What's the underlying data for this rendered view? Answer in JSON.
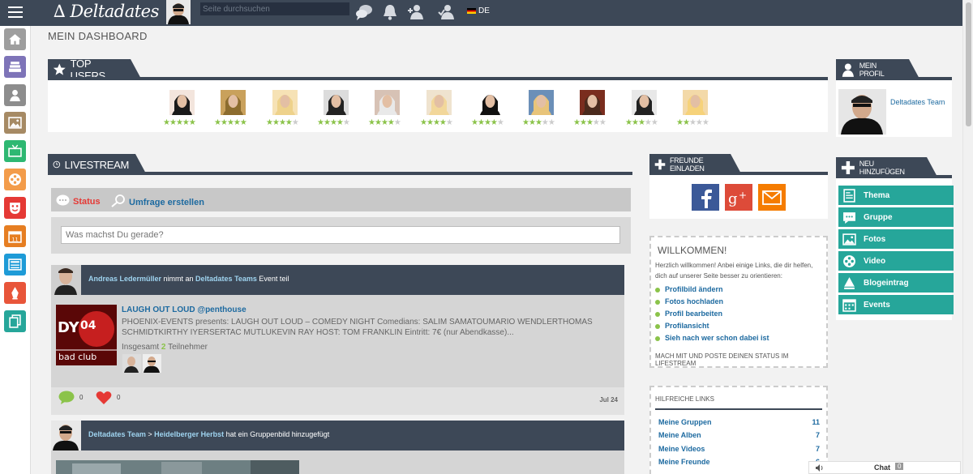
{
  "topbar": {
    "logo": "∆ Deltadates",
    "search_placeholder": "Seite durchsuchen",
    "language": "DE"
  },
  "page_title": "MEIN DASHBOARD",
  "top_users": {
    "title": "TOP USERS",
    "ratings": [
      5,
      5,
      4.5,
      4,
      4,
      4,
      4,
      3,
      3,
      3,
      2
    ]
  },
  "livestream": {
    "title": "LIVESTREAM",
    "status_label": "Status",
    "poll_label": "Umfrage erstellen",
    "composer_placeholder": "Was machst Du gerade?",
    "posts": [
      {
        "author": "Andreas Ledermüller",
        "action_pre": " nimmt an ",
        "target": "Deltadates Teams",
        "action_post": " Event teil",
        "event_title": "LAUGH OUT LOUD @penthouse",
        "event_desc": "PHOENIX-EVENTS presents: LAUGH OUT LOUD – COMEDY NIGHT Comedians: SALIM SAMATOUMARIO WENDLERTHOMAS SCHMIDTKIRTHY IYERSERTAC MUTLUKEVIN RAY HOST: TOM FRANKLIN Eintritt: 7€ (nur Abendkasse)...",
        "participants_pre": "Insgesamt ",
        "participants_count": "2",
        "participants_post": " Teilnehmer",
        "comments": "0",
        "likes": "0",
        "date": "Jul 24"
      },
      {
        "author": "Deltadates Team",
        "sep": " > ",
        "target": "Heidelberger Herbst",
        "action_post": " hat ein Gruppenbild hinzugefügt"
      }
    ]
  },
  "invite": {
    "title": "FREUNDE EINLADEN"
  },
  "welcome": {
    "title": "WILLKOMMEN!",
    "text": "Herzlich willkommen! Anbei einige Links, die dir helfen, dich auf unserer Seite besser zu orientieren:",
    "links": [
      "Profilbild ändern",
      "Fotos hochladen",
      "Profil bearbeiten",
      "Profilansicht",
      "Sieh nach wer schon dabei ist"
    ],
    "footer": "MACH MIT UND POSTE DEINEN STATUS IM LIFESTREAM"
  },
  "helpful_links": {
    "title": "HILFREICHE LINKS",
    "rows": [
      {
        "label": "Meine Gruppen",
        "count": "11"
      },
      {
        "label": "Meine Alben",
        "count": "7"
      },
      {
        "label": "Meine Videos",
        "count": "7"
      },
      {
        "label": "Meine Freunde",
        "count": "6"
      }
    ]
  },
  "profile": {
    "title": "MEIN PROFIL",
    "name": "Deltadates Team"
  },
  "add_new": {
    "title": "NEU HINZUFÜGEN",
    "items": [
      "Thema",
      "Gruppe",
      "Fotos",
      "Video",
      "Blogeintrag",
      "Events"
    ]
  },
  "chat": {
    "label": "Chat",
    "count": "0"
  },
  "colors": {
    "header": "#3d4857",
    "accent": "#26a69a",
    "link": "#1d6aa0",
    "star": "#8bc34a",
    "status_red": "#e53935"
  }
}
